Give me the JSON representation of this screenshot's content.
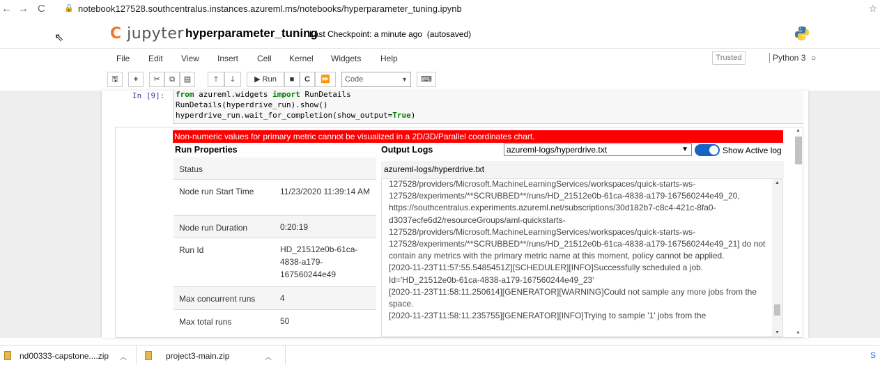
{
  "browser": {
    "url": "notebook127528.southcentralus.instances.azureml.ms/notebooks/hyperparameter_tuning.ipynb",
    "back_icon": "arrow-left-icon",
    "forward_icon": "arrow-right-icon",
    "reload_icon": "reload-icon",
    "lock_icon": "lock-icon",
    "star_icon": "star-icon"
  },
  "header": {
    "logo_text": "jupyter",
    "notebook_name": "hyperparameter_tuning",
    "checkpoint": "Last Checkpoint: a minute ago",
    "autosave": "(autosaved)"
  },
  "menu": {
    "items": [
      "File",
      "Edit",
      "View",
      "Insert",
      "Cell",
      "Kernel",
      "Widgets",
      "Help"
    ],
    "trusted": "Trusted",
    "kernel": "Python 3"
  },
  "toolbar": {
    "run_label": "Run",
    "cell_type": "Code"
  },
  "cell": {
    "prompt": "In [9]:",
    "code": [
      {
        "kw": "from",
        "rest1": " azureml.widgets ",
        "kw2": "import",
        "rest2": " RunDetails"
      },
      {
        "text": "RunDetails(hyperdrive_run).show()"
      },
      {
        "text": "hyperdrive_run.wait_for_completion(show_output=",
        "kw": "True",
        "tail": ")"
      }
    ]
  },
  "widget": {
    "warning": "Non-numeric values for primary metric cannot be visualized in a 2D/3D/Parallel coordinates chart.",
    "run_properties_title": "Run Properties",
    "output_logs_title": "Output Logs",
    "log_select": "azureml-logs/hyperdrive.txt",
    "toggle_label": "Show Active log",
    "toggle_on": true,
    "log_file_header": "azureml-logs/hyperdrive.txt",
    "properties": [
      {
        "key": "Status",
        "value": ""
      },
      {
        "key": "Node run Start Time",
        "value": "11/23/2020 11:39:14 AM"
      },
      {
        "key": "Node run Duration",
        "value": "0:20:19"
      },
      {
        "key": "Run Id",
        "value": "HD_21512e0b-61ca-4838-a179-167560244e49"
      },
      {
        "key": "Max concurrent runs",
        "value": "4"
      },
      {
        "key": "Max total runs",
        "value": "50"
      }
    ],
    "log_lines": [
      "127528/providers/Microsoft.MachineLearningServices/workspaces/quick-starts-ws-127528/experiments/**SCRUBBED**/runs/HD_21512e0b-61ca-4838-a179-167560244e49_20, https://southcentralus.experiments.azureml.net/subscriptions/30d182b7-c8c4-421c-8fa0-d3037ecfe6d2/resourceGroups/aml-quickstarts-127528/providers/Microsoft.MachineLearningServices/workspaces/quick-starts-ws-127528/experiments/**SCRUBBED**/runs/HD_21512e0b-61ca-4838-a179-167560244e49_21] do not contain any metrics with the primary metric name at this moment, policy cannot be applied.",
      "[2020-11-23T11:57:55.5485451Z][SCHEDULER][INFO]Successfully scheduled a job. Id='HD_21512e0b-61ca-4838-a179-167560244e49_23'",
      "[2020-11-23T11:58:11.250614][GENERATOR][WARNING]Could not sample any more jobs from the space.",
      "[2020-11-23T11:58:11.235755][GENERATOR][INFO]Trying to sample '1' jobs from the"
    ]
  },
  "downloads": [
    {
      "name": "nd00333-capstone....zip"
    },
    {
      "name": "project3-main.zip"
    }
  ],
  "downloads_show_all": "S"
}
